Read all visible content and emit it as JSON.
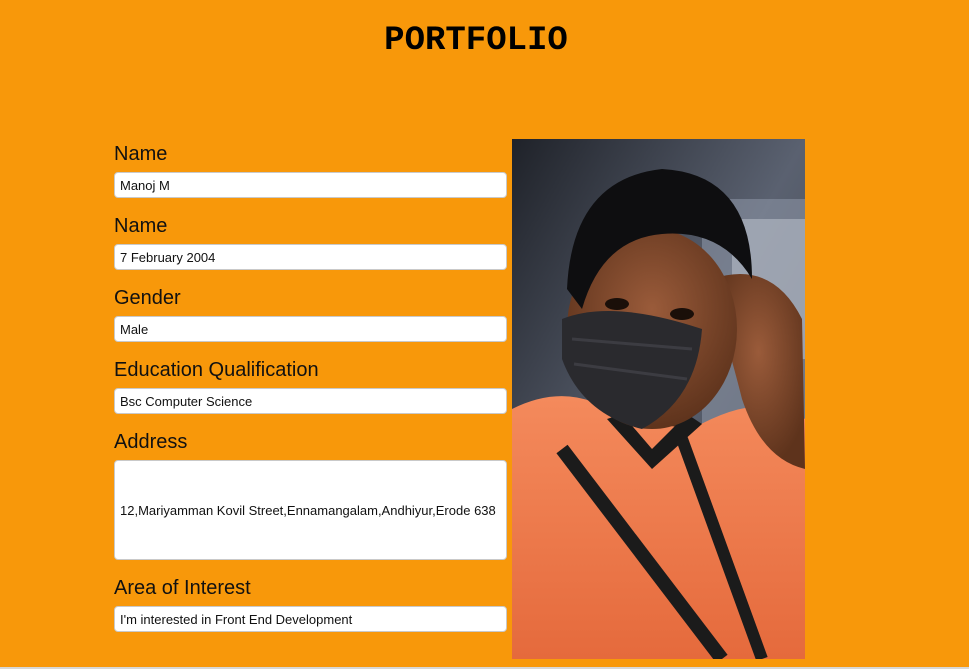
{
  "header": {
    "title": "PORTFOLIO"
  },
  "form": {
    "fields": [
      {
        "label": "Name",
        "value": "Manoj M"
      },
      {
        "label": "Name",
        "value": "7 February 2004"
      },
      {
        "label": "Gender",
        "value": "Male"
      },
      {
        "label": "Education Qualification",
        "value": "Bsc Computer Science"
      },
      {
        "label": "Address",
        "value": "12,Mariyamman Kovil Street,Ennamangalam,Andhiyur,Erode 638"
      },
      {
        "label": "Area of Interest",
        "value": "I'm interested in Front End Development"
      }
    ]
  },
  "photo": {
    "icon": "profile-photo"
  },
  "colors": {
    "background": "#F8980A",
    "input_bg": "#FFFFFF"
  }
}
